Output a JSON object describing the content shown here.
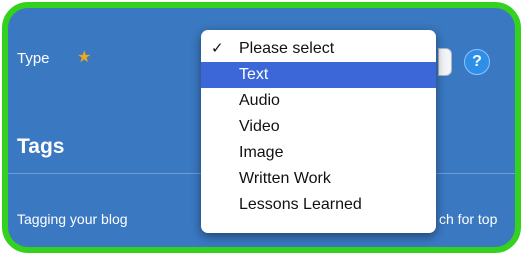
{
  "form": {
    "type_label": "Type",
    "required_icon": "star-icon",
    "help_label": "?",
    "tags_heading": "Tags",
    "tags_text_left": "Tagging your blog",
    "tags_text_right": "ch for top"
  },
  "dropdown": {
    "checked_option": "Please select",
    "highlighted_option": "Text",
    "options": [
      "Please select",
      "Text",
      "Audio",
      "Video",
      "Image",
      "Written Work",
      "Lessons Learned"
    ]
  },
  "colors": {
    "frame_border": "#35d11f",
    "panel_background": "#3a78c2",
    "highlight": "#3b67d9",
    "star": "#f0a81e"
  }
}
